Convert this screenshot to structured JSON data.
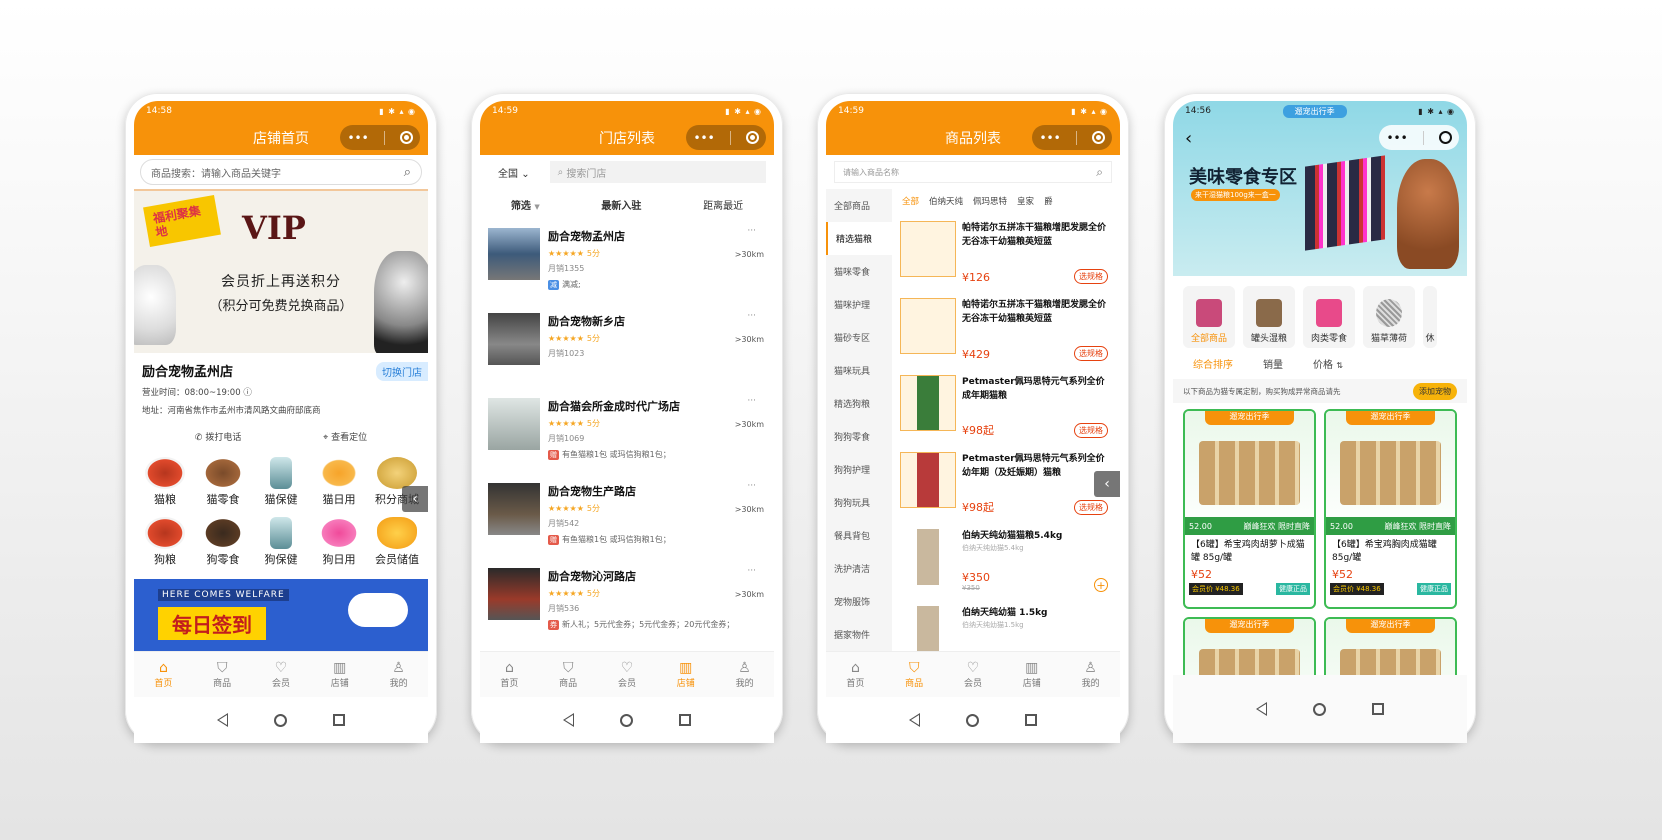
{
  "common": {
    "tabs": [
      "首页",
      "商品",
      "会员",
      "店铺",
      "我的"
    ],
    "capsule_more": "•••"
  },
  "p1": {
    "time": "14:58",
    "title": "店铺首页",
    "search_placeholder": "商品搜索：请输入商品关键字",
    "banner": {
      "badge": "福利聚集地",
      "vip": "VIP",
      "line1": "会员折上再送积分",
      "line2": "（积分可免费兑换商品）"
    },
    "shop_name": "励合宠物孟州店",
    "switch_label": "切换门店",
    "hours": "营业时间：08:00~19:00",
    "address": "地址：河南省焦作市孟州市清风路文曲府邸底商",
    "call": "拨打电话",
    "locate": "查看定位",
    "grid": [
      "猫粮",
      "猫零食",
      "猫保健",
      "猫日用",
      "积分商城",
      "狗粮",
      "狗零食",
      "狗保健",
      "狗日用",
      "会员储值"
    ],
    "welfare_top": "HERE COMES WELFARE",
    "welfare_title": "每日签到"
  },
  "p2": {
    "time": "14:59",
    "title": "门店列表",
    "region": "全国",
    "search_placeholder": "搜索门店",
    "filters": [
      "筛选",
      "最新入驻",
      "距离最近"
    ],
    "stores": [
      {
        "name": "励合宠物孟州店",
        "score": "5分",
        "sales": "月销1355",
        "note": "满减;",
        "tag": "减",
        "dist": ">30km"
      },
      {
        "name": "励合宠物新乡店",
        "score": "5分",
        "sales": "月销1023",
        "note": "",
        "tag": "",
        "dist": ">30km"
      },
      {
        "name": "励合猫会所金成时代广场店",
        "score": "5分",
        "sales": "月销1069",
        "note": "有鱼猫粮1包 或玛信狗粮1包；",
        "tag": "赠",
        "dist": ">30km"
      },
      {
        "name": "励合宠物生产路店",
        "score": "5分",
        "sales": "月销542",
        "note": "有鱼猫粮1包 或玛信狗粮1包；",
        "tag": "赠",
        "dist": ">30km"
      },
      {
        "name": "励合宠物沁河路店",
        "score": "5分",
        "sales": "月销536",
        "note": "新人礼；5元代金券；5元代金券；20元代金券；",
        "tag": "券",
        "dist": ">30km"
      }
    ]
  },
  "p3": {
    "time": "14:59",
    "title": "商品列表",
    "search_placeholder": "请输入商品名称",
    "sidebar": [
      "全部商品",
      "精选猫粮",
      "猫咪零食",
      "猫咪护理",
      "猫砂专区",
      "猫咪玩具",
      "精选狗粮",
      "狗狗零食",
      "狗狗护理",
      "狗狗玩具",
      "餐具背包",
      "洗护清洁",
      "宠物服饰",
      "据家物件"
    ],
    "cats": [
      "全部",
      "伯纳天纯",
      "佩玛思特",
      "皇家",
      "爵"
    ],
    "products": [
      {
        "name": "帕特诺尔五拼冻干猫粮增肥发腮全价无谷冻干幼猫粮英短蓝",
        "sub": "",
        "price": "¥126",
        "old": "",
        "action": "选规格"
      },
      {
        "name": "帕特诺尔五拼冻干猫粮增肥发腮全价无谷冻干幼猫粮英短蓝",
        "sub": "",
        "price": "¥429",
        "old": "",
        "action": "选规格"
      },
      {
        "name": "Petmaster佩玛思特元气系列全价成年期猫粮",
        "sub": "",
        "price": "¥98起",
        "old": "",
        "action": "选规格"
      },
      {
        "name": "Petmaster佩玛思特元气系列全价幼年期（及妊娠期）猫粮",
        "sub": "",
        "price": "¥98起",
        "old": "",
        "action": "选规格"
      },
      {
        "name": "伯纳天纯幼猫猫粮5.4kg",
        "sub": "伯纳天纯幼猫5.4kg",
        "price": "¥350",
        "old": "¥350",
        "action": "+"
      },
      {
        "name": "伯纳天纯幼猫 1.5kg",
        "sub": "伯纳天纯幼猫1.5kg",
        "price": "",
        "old": "",
        "action": ""
      }
    ]
  },
  "p4": {
    "time": "14:56",
    "hero_title": "美味零食专区",
    "hero_sub": "来干湿猫粮100g来一盒一",
    "top_label": "遛宠出行季",
    "cats": [
      "全部商品",
      "罐头湿粮",
      "肉类零食",
      "猫草薄荷",
      "休"
    ],
    "sort": [
      "综合排序",
      "销量",
      "价格"
    ],
    "tip": "以下商品为猫专属定制，购买狗成异常商品请先",
    "tip_btn": "添加宠物",
    "goods": [
      {
        "banner": "遛宠出行季",
        "price_tag": "52.00",
        "strip": "巅峰狂欢 限时直降",
        "name": "【6罐】希宝鸡肉胡萝卜成猫罐 85g/罐",
        "price": "¥52",
        "member": "会员价 ¥48.36",
        "badge": "健康正品"
      },
      {
        "banner": "遛宠出行季",
        "price_tag": "52.00",
        "strip": "巅峰狂欢 限时直降",
        "name": "【6罐】希宝鸡胸肉成猫罐 85g/罐",
        "price": "¥52",
        "member": "会员价 ¥48.36",
        "badge": "健康正品"
      },
      {
        "banner": "遛宠出行季"
      },
      {
        "banner": "遛宠出行季"
      }
    ]
  }
}
